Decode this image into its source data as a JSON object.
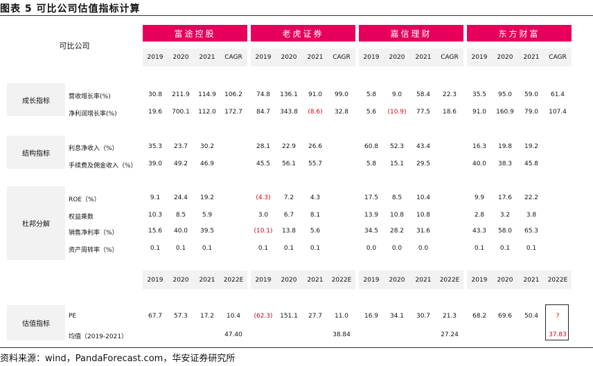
{
  "title": "图表 5 可比公司估值指标计算",
  "source": "资料来源：wind，PandaForecast.com，华安证券研究所",
  "header": {
    "company_label": "可比公司",
    "companies": [
      "富途控股",
      "老虎证券",
      "嘉信理财",
      "东方财富"
    ],
    "years_top": [
      "2019",
      "2020",
      "2021",
      "CAGR"
    ],
    "years_bottom": [
      "2019",
      "2020",
      "2021",
      "2022E"
    ]
  },
  "groups": [
    {
      "label": "成长指标",
      "rows": [
        {
          "label": "营收增长率(%)",
          "values": [
            "30.8",
            "211.9",
            "114.9",
            "106.2",
            "74.8",
            "136.1",
            "91.0",
            "99.0",
            "5.8",
            "9.0",
            "58.4",
            "22.3",
            "35.5",
            "95.0",
            "59.0",
            "61.4"
          ]
        },
        {
          "label": "净利润增长率(%)",
          "values": [
            "19.6",
            "700.1",
            "112.0",
            "172.7",
            "84.7",
            "343.8",
            "(8.6)",
            "32.8",
            "5.6",
            "(10.9)",
            "77.5",
            "18.6",
            "91.0",
            "160.9",
            "79.0",
            "107.4"
          ]
        }
      ]
    },
    {
      "label": "结构指标",
      "rows": [
        {
          "label": "利息净收入（%）",
          "values": [
            "35.3",
            "23.7",
            "30.2",
            "",
            "28.1",
            "22.9",
            "26.6",
            "",
            "60.8",
            "52.3",
            "43.4",
            "",
            "16.3",
            "19.8",
            "19.2",
            ""
          ]
        },
        {
          "label": "手续费及佣金收入（%）",
          "values": [
            "39.0",
            "49.2",
            "46.9",
            "",
            "45.5",
            "56.1",
            "55.7",
            "",
            "5.8",
            "15.1",
            "29.5",
            "",
            "40.0",
            "38.3",
            "45.8",
            ""
          ]
        }
      ]
    },
    {
      "label": "杜邦分解",
      "rows": [
        {
          "label": "ROE（%）",
          "values": [
            "9.1",
            "24.4",
            "19.2",
            "",
            "(4.3)",
            "7.2",
            "4.3",
            "",
            "17.5",
            "8.5",
            "10.4",
            "",
            "9.9",
            "17.6",
            "22.2",
            ""
          ]
        },
        {
          "label": "权益乘数",
          "values": [
            "10.3",
            "8.5",
            "5.9",
            "",
            "3.0",
            "6.7",
            "8.1",
            "",
            "13.9",
            "10.8",
            "10.8",
            "",
            "2.8",
            "3.2",
            "3.8",
            ""
          ]
        },
        {
          "label": "销售净利率（%）",
          "values": [
            "15.6",
            "40.0",
            "39.5",
            "",
            "(10.1)",
            "13.8",
            "5.6",
            "",
            "34.5",
            "28.2",
            "31.6",
            "",
            "43.3",
            "58.0",
            "65.3",
            ""
          ]
        },
        {
          "label": "资产周转率（%）",
          "values": [
            "0.1",
            "0.1",
            "0.1",
            "",
            "0.1",
            "0.1",
            "0.1",
            "",
            "0.0",
            "0.0",
            "0.0",
            "",
            "0.1",
            "0.1",
            "0.1",
            ""
          ]
        }
      ]
    },
    {
      "label": "估值指标",
      "rows": [
        {
          "label": "PE",
          "values": [
            "67.7",
            "57.3",
            "17.2",
            "10.4",
            "(62.3)",
            "151.1",
            "27.7",
            "11.0",
            "16.9",
            "34.1",
            "30.7",
            "21.3",
            "68.2",
            "69.6",
            "50.4",
            "?"
          ]
        },
        {
          "label": "均值（2019-2021）",
          "values": [
            "",
            "",
            "",
            "47.40",
            "",
            "",
            "",
            "38.84",
            "",
            "",
            "",
            "27.24",
            "",
            "",
            "",
            "37.83"
          ]
        }
      ]
    }
  ],
  "colors": {
    "header_bg": "#e5005c",
    "negative": "#d0021b",
    "band": "#f2f2f2"
  }
}
